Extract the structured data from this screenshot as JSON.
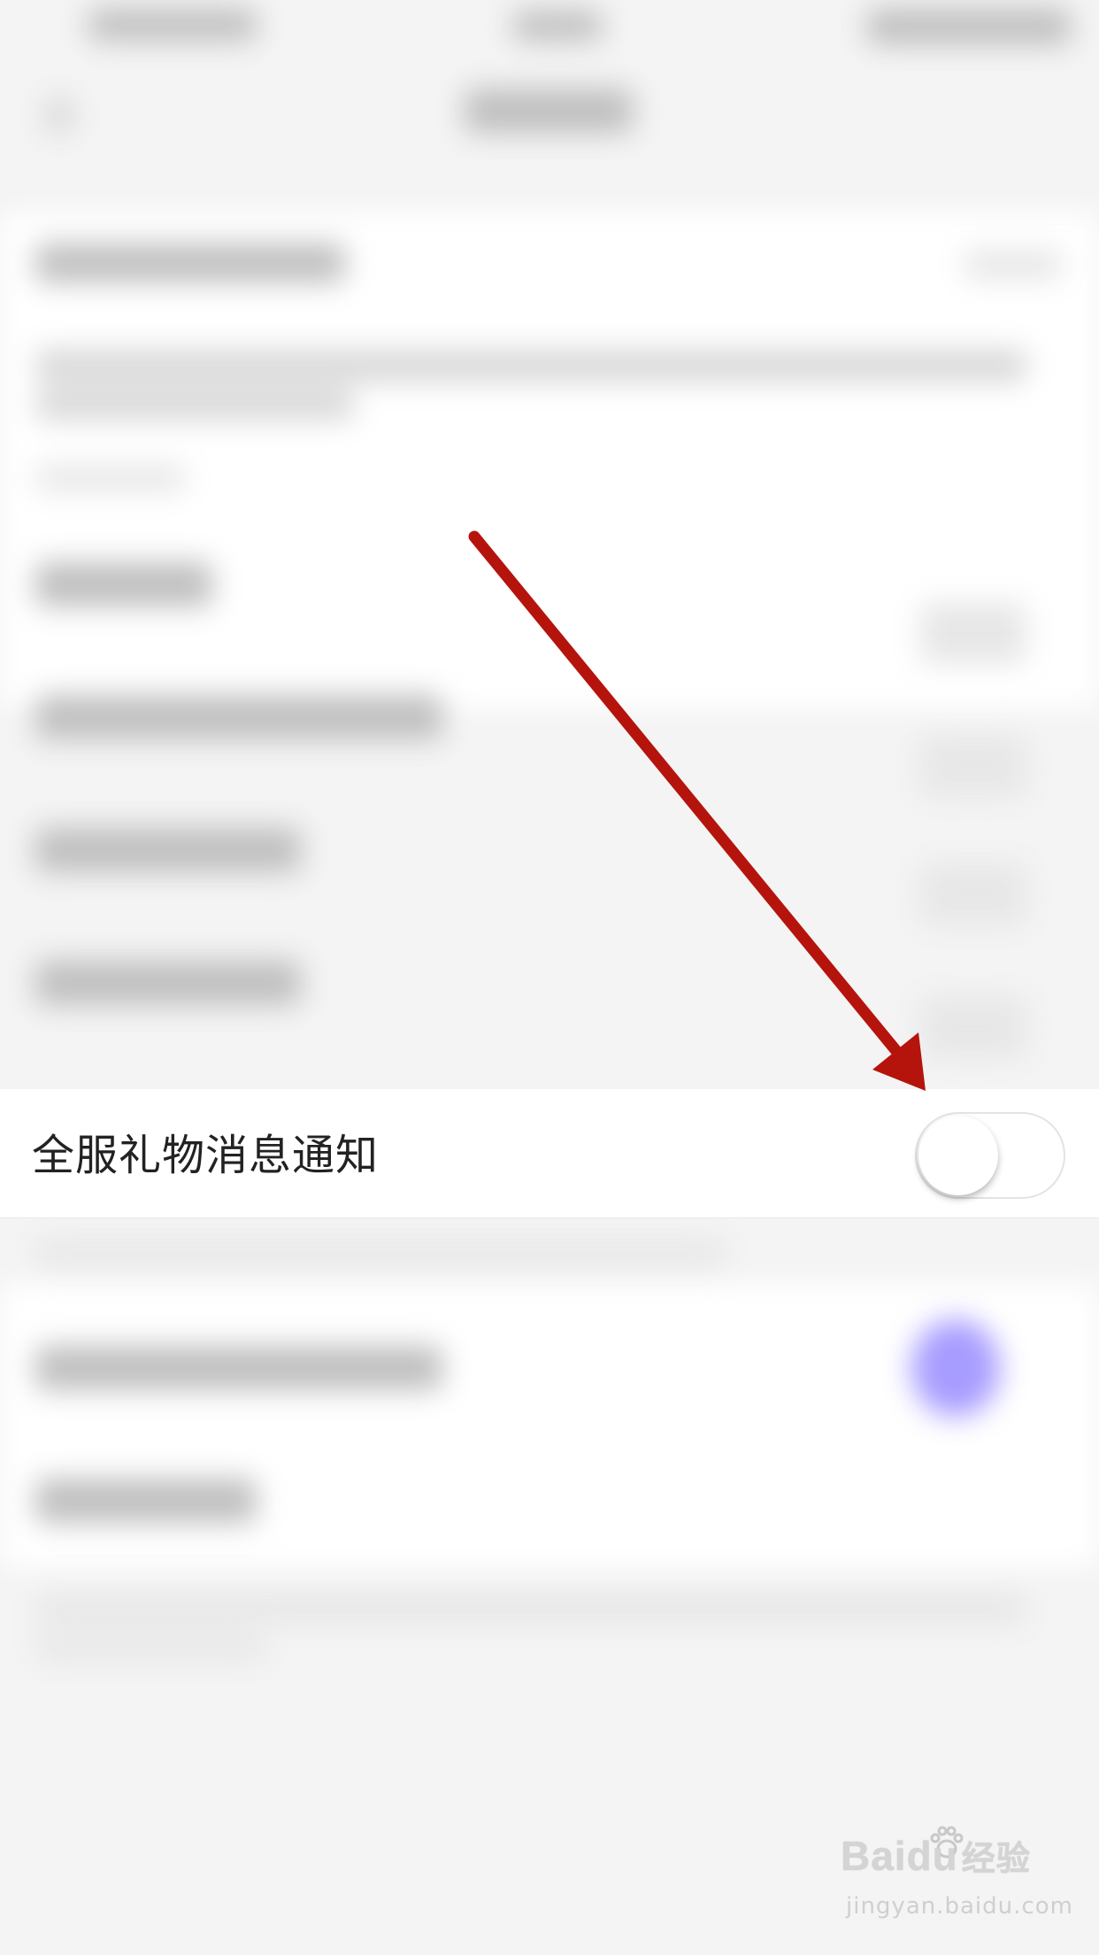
{
  "setting_row": {
    "label": "全服礼物消息通知",
    "toggle_state": "off"
  },
  "watermark": {
    "logo": "Baidu",
    "sublogo": "经验",
    "url": "jingyan.baidu.com"
  },
  "colors": {
    "arrow": "#b5140d",
    "background": "#f4f4f4",
    "row_background": "#ffffff",
    "blurred_accent": "#a79cff"
  },
  "icons": {
    "arrow": "annotation-arrow-icon",
    "toggle": "toggle-switch",
    "watermark_paw": "paw-icon"
  }
}
